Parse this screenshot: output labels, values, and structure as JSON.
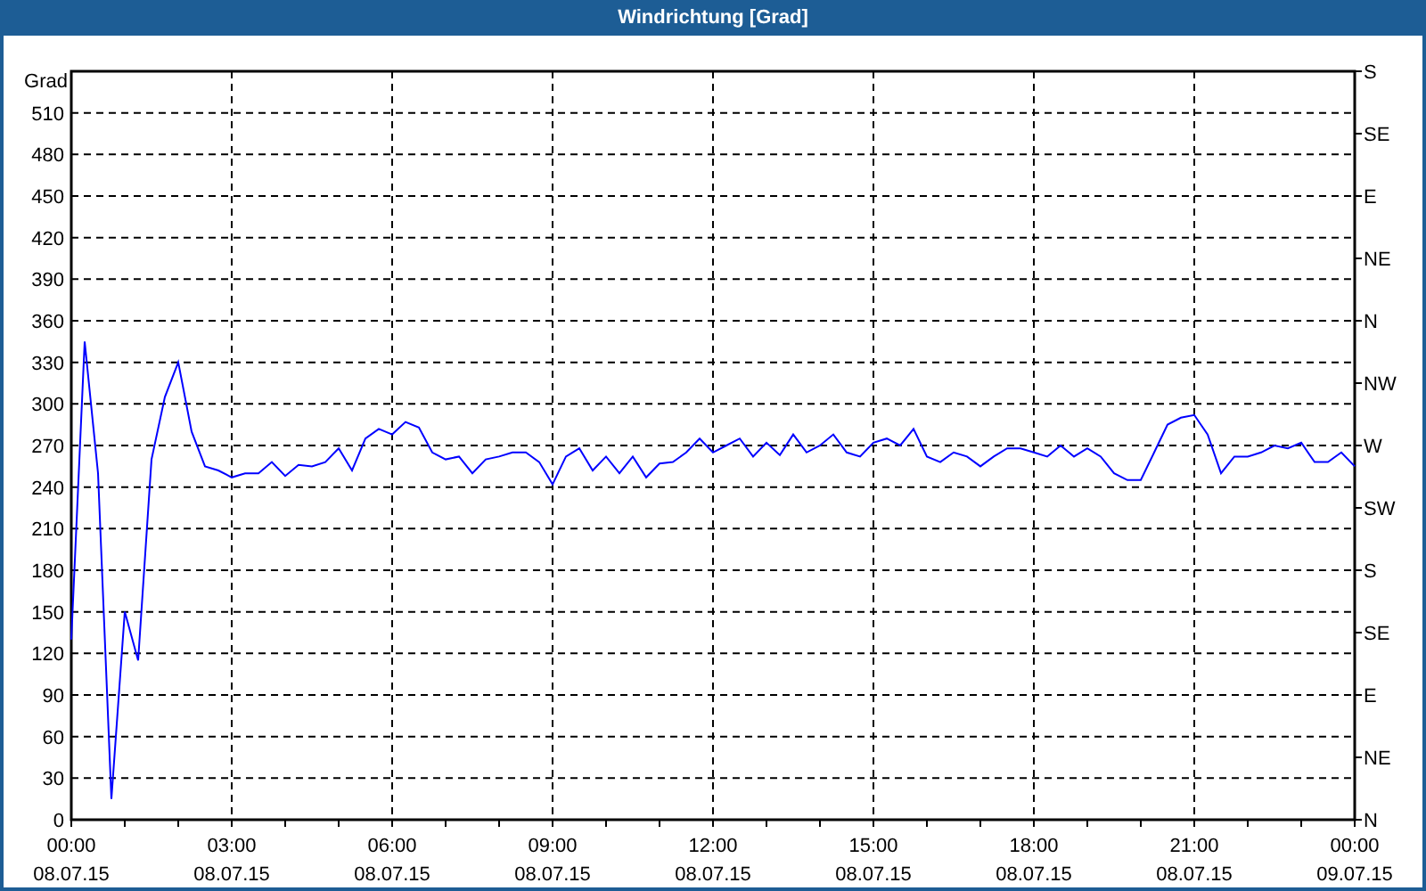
{
  "window": {
    "title": "Windrichtung [Grad]"
  },
  "chart": {
    "chart_data": {
      "type": "line",
      "grid": true,
      "ylabel": "Grad",
      "ylim": [
        0,
        540
      ],
      "yticks": [
        0,
        30,
        60,
        90,
        120,
        150,
        180,
        210,
        240,
        270,
        300,
        330,
        360,
        390,
        420,
        450,
        480,
        510
      ],
      "categories": [
        "00:00 08.07.15",
        null,
        null,
        null,
        null,
        null,
        null,
        null,
        null,
        null,
        null,
        null,
        "03:00 08.07.15",
        null,
        null,
        null,
        null,
        null,
        null,
        null,
        null,
        null,
        null,
        null,
        "06:00 08.07.15",
        null,
        null,
        null,
        null,
        null,
        null,
        null,
        null,
        null,
        null,
        null,
        "09:00 08.07.15",
        null,
        null,
        null,
        null,
        null,
        null,
        null,
        null,
        null,
        null,
        null,
        "12:00 08.07.15",
        null,
        null,
        null,
        null,
        null,
        null,
        null,
        null,
        null,
        null,
        null,
        "15:00 08.07.15",
        null,
        null,
        null,
        null,
        null,
        null,
        null,
        null,
        null,
        null,
        null,
        "18:00 08.07.15",
        null,
        null,
        null,
        null,
        null,
        null,
        null,
        null,
        null,
        null,
        null,
        "21:00 08.07.15",
        null,
        null,
        null,
        null,
        null,
        null,
        null,
        null,
        null,
        null,
        null,
        "00:00 09.07.15"
      ],
      "series": [
        {
          "color": "#0000ff",
          "values": [
            130,
            345,
            250,
            15,
            150,
            115,
            260,
            305,
            330,
            280,
            255,
            252,
            247,
            250,
            250,
            258,
            248,
            256,
            255,
            258,
            268,
            252,
            275,
            282,
            278,
            287,
            283,
            265,
            260,
            262,
            250,
            260,
            262,
            265,
            265,
            258,
            242,
            262,
            268,
            252,
            262,
            250,
            262,
            247,
            257,
            258,
            265,
            275,
            265,
            270,
            275,
            262,
            272,
            263,
            278,
            265,
            270,
            278,
            265,
            262,
            272,
            275,
            270,
            282,
            262,
            258,
            265,
            262,
            255,
            262,
            268,
            268,
            265,
            262,
            270,
            262,
            268,
            262,
            250,
            245,
            245,
            265,
            285,
            290,
            292,
            278,
            250,
            262,
            262,
            265,
            270,
            268,
            272,
            258,
            258,
            265,
            255
          ]
        }
      ]
    },
    "compass_axis": {
      "labels": [
        "S",
        "SE",
        "E",
        "NE",
        "N",
        "NW",
        "W",
        "SW",
        "S",
        "SE",
        "E",
        "NE",
        "N"
      ]
    }
  }
}
